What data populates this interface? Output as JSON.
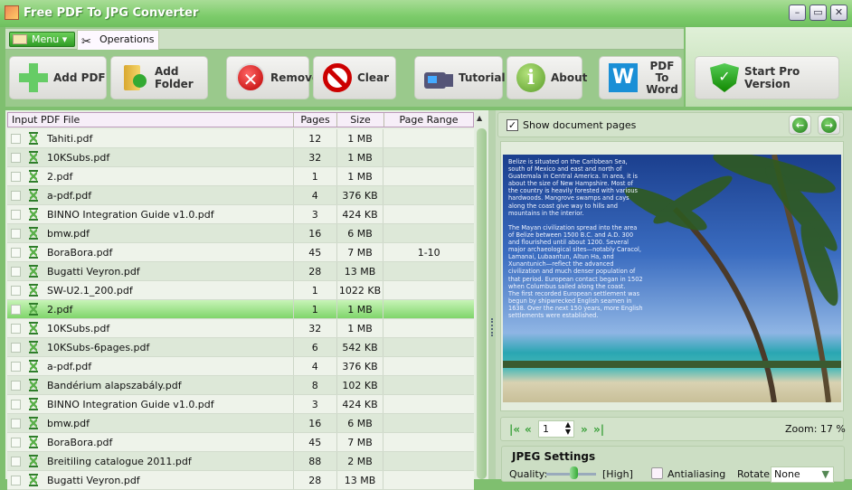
{
  "window": {
    "title": "Free PDF To JPG Converter",
    "minimize": "–",
    "maximize": "▭",
    "close": "✕"
  },
  "tabs": {
    "menu": "Menu",
    "operations": "Operations"
  },
  "toolbar": {
    "add_pdf": "Add PDF",
    "add_folder": "Add Folder",
    "remove": "Remove",
    "clear": "Clear",
    "tutorial": "Tutorial",
    "about": "About",
    "pdf_to_word": "PDF To Word",
    "pdf_to_word_icon": "W",
    "start_pro": "Start Pro Version"
  },
  "table": {
    "columns": [
      "Input PDF File",
      "Pages",
      "Size",
      "Page Range"
    ],
    "rows": [
      {
        "name": "Tahiti.pdf",
        "pages": "12",
        "size": "1 MB",
        "range": ""
      },
      {
        "name": "10KSubs.pdf",
        "pages": "32",
        "size": "1 MB",
        "range": ""
      },
      {
        "name": "2.pdf",
        "pages": "1",
        "size": "1 MB",
        "range": ""
      },
      {
        "name": "a-pdf.pdf",
        "pages": "4",
        "size": "376 KB",
        "range": ""
      },
      {
        "name": "BINNO Integration Guide v1.0.pdf",
        "pages": "3",
        "size": "424 KB",
        "range": ""
      },
      {
        "name": "bmw.pdf",
        "pages": "16",
        "size": "6 MB",
        "range": ""
      },
      {
        "name": "BoraBora.pdf",
        "pages": "45",
        "size": "7 MB",
        "range": "1-10"
      },
      {
        "name": "Bugatti Veyron.pdf",
        "pages": "28",
        "size": "13 MB",
        "range": ""
      },
      {
        "name": "SW-U2.1_200.pdf",
        "pages": "1",
        "size": "1022 KB",
        "range": ""
      },
      {
        "name": "2.pdf",
        "pages": "1",
        "size": "1 MB",
        "range": "",
        "selected": true
      },
      {
        "name": "10KSubs.pdf",
        "pages": "32",
        "size": "1 MB",
        "range": ""
      },
      {
        "name": "10KSubs-6pages.pdf",
        "pages": "6",
        "size": "542 KB",
        "range": ""
      },
      {
        "name": "a-pdf.pdf",
        "pages": "4",
        "size": "376 KB",
        "range": ""
      },
      {
        "name": "Bandérium alapszabály.pdf",
        "pages": "8",
        "size": "102 KB",
        "range": ""
      },
      {
        "name": "BINNO Integration Guide v1.0.pdf",
        "pages": "3",
        "size": "424 KB",
        "range": ""
      },
      {
        "name": "bmw.pdf",
        "pages": "16",
        "size": "6 MB",
        "range": ""
      },
      {
        "name": "BoraBora.pdf",
        "pages": "45",
        "size": "7 MB",
        "range": ""
      },
      {
        "name": "Breitiling catalogue 2011.pdf",
        "pages": "88",
        "size": "2 MB",
        "range": ""
      },
      {
        "name": "Bugatti Veyron.pdf",
        "pages": "28",
        "size": "13 MB",
        "range": ""
      }
    ]
  },
  "preview": {
    "show_pages_label": "Show document pages",
    "show_pages_checked": true,
    "prev": "←",
    "next": "→",
    "text": "Belize is situated on the Caribbean Sea, south of Mexico and east and north of Guatemala in Central America. In area, it is about the size of New Hampshire. Most of the country is heavily forested with various hardwoods. Mangrove swamps and cays along the coast give way to hills and mountains in the interior.\n\nThe Mayan civilization spread into the area of Belize between 1500 B.C. and A.D. 300 and flourished until about 1200. Several major archaeological sites—notably Caracol, Lamanai, Lubaantun, Altun Ha, and Xunantunich—reflect the advanced civilization and much denser population of that period. European contact began in 1502 when Columbus sailed along the coast.\nThe first recorded European settlement was begun by shipwrecked English seamen in 1638. Over the next 150 years, more English settlements were established."
  },
  "pager": {
    "first": "|«",
    "prev": "«",
    "page": "1",
    "next": "»",
    "last": "»|",
    "zoom": "Zoom: 17 %"
  },
  "jpeg": {
    "title": "JPEG Settings",
    "quality_label": "Quality:",
    "quality_value": "[High]",
    "antialiasing": "Antialiasing",
    "antialiasing_checked": false,
    "rotate_label": "Rotate:",
    "rotate_value": "None"
  },
  "colors": {
    "accent": "#6fbf5f",
    "selected_row": "#7fd56a"
  }
}
